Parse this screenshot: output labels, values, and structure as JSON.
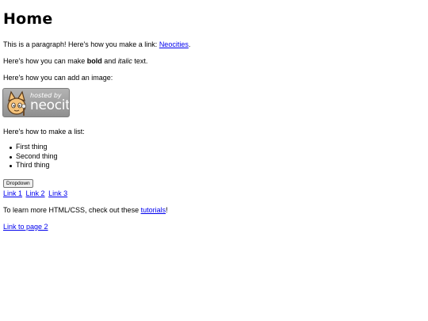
{
  "heading": "Home",
  "para1": {
    "text": "This is a paragraph! Here's how you make a link: ",
    "link": "Neocities",
    "after": "."
  },
  "para2": {
    "before": "Here's how you can make ",
    "bold": "bold",
    "middle": " and ",
    "italic": "italic",
    "after": " text."
  },
  "para3": "Here's how you can add an image:",
  "badge": {
    "small": "hosted by",
    "big": "neocities"
  },
  "para4": "Here's how to make a list:",
  "list": [
    "First thing",
    "Second thing",
    "Third thing"
  ],
  "dropdown": {
    "label": "Dropdown",
    "links": [
      "Link 1",
      "Link 2",
      "Link 3"
    ]
  },
  "para5": {
    "before": "To learn more HTML/CSS, check out these ",
    "link": "tutorials",
    "after": "!"
  },
  "page2_link": "Link to page 2"
}
